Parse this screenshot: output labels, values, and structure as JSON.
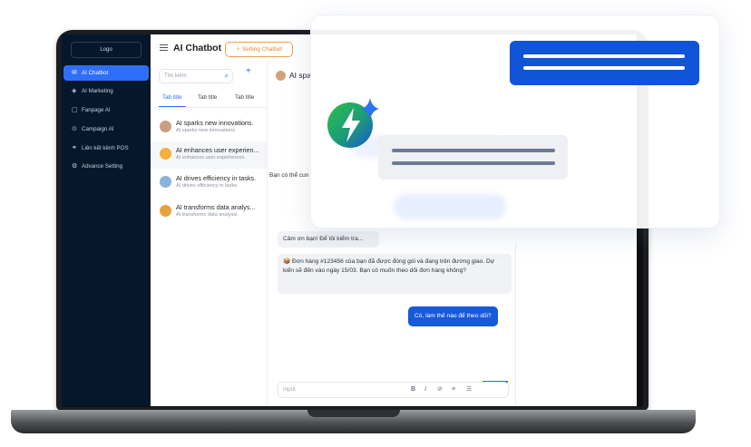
{
  "sidebar": {
    "logo": "Logo",
    "items": [
      {
        "label": "AI Chatbot",
        "icon": "chat-icon",
        "active": true
      },
      {
        "label": "AI Marketing",
        "icon": "marketing-icon"
      },
      {
        "label": "Fanpage AI",
        "icon": "page-icon"
      },
      {
        "label": "Campaign AI",
        "icon": "campaign-icon"
      },
      {
        "label": "Liên kết kênh POS",
        "icon": "link-icon"
      },
      {
        "label": "Advance Setting",
        "icon": "gear-icon"
      }
    ]
  },
  "header": {
    "title": "AI Chatbot",
    "setting_button": "Setting Chatbot"
  },
  "conversations": {
    "search_placeholder": "Tìm kiếm",
    "tabs": [
      "Tab title",
      "Tab title",
      "Tab title"
    ],
    "items": [
      {
        "title": "AI sparks new innovations.",
        "subtitle": "AI sparks new innovations."
      },
      {
        "title": "AI enhances user experien...",
        "subtitle": "AI enhances user experiences."
      },
      {
        "title": "AI drives efficiency in tasks.",
        "subtitle": "AI drives efficiency in tasks."
      },
      {
        "title": "AI transforms data analys...",
        "subtitle": "AI transforms data analysis."
      }
    ]
  },
  "chat": {
    "contact_name": "AI spa",
    "partial_message": "Bạn có thể cun",
    "messages": [
      {
        "from": "bot",
        "text": "Cảm ơn bạn! Để tôi kiểm tra..."
      },
      {
        "from": "bot",
        "text": "📦 Đơn hàng #123456 của bạn đã được đóng gói và đang trên đường giao. Dự kiến sẽ đến vào ngày 15/03. Bạn có muốn theo dõi đơn hàng không?"
      },
      {
        "from": "user",
        "text": "Có, làm thế nào để theo dõi?"
      }
    ],
    "input_placeholder": "Input",
    "toolbar": [
      "B",
      "I",
      "⊘",
      "≡",
      "☰"
    ]
  },
  "colors": {
    "sidebar": "#06172b",
    "accent": "#2f6ef7",
    "user_bubble": "#1659d9",
    "setting_button": "#e48a2b"
  }
}
